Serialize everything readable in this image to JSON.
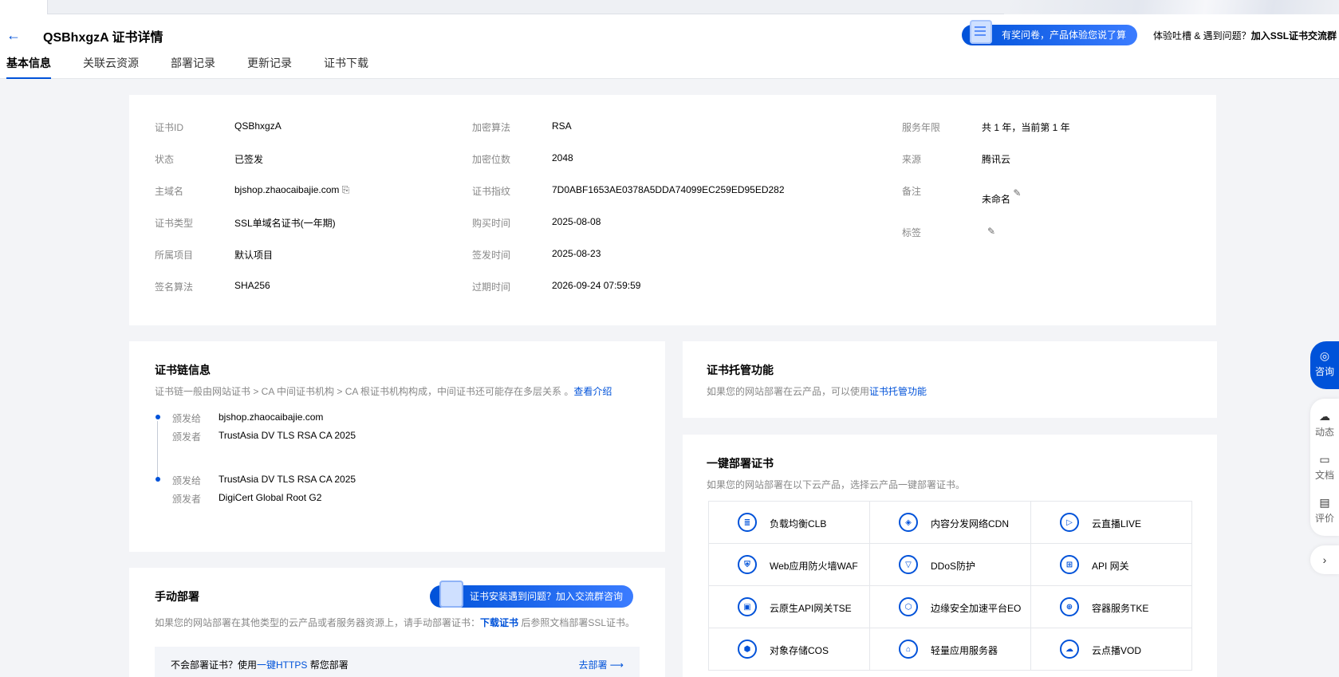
{
  "header": {
    "back_icon": "arrow-left-icon",
    "title": "QSBhxgzA 证书详情",
    "survey_label": "有奖问卷，产品体验您说了算",
    "feedback_prefix": "体验吐槽 & 遇到问题？",
    "feedback_link": "加入SSL证书交流群",
    "tabs": [
      "基本信息",
      "关联云资源",
      "部署记录",
      "更新记录",
      "证书下载"
    ]
  },
  "info": {
    "col1": [
      {
        "k": "证书ID",
        "v": "QSBhxgzA"
      },
      {
        "k": "状态",
        "v": "已签发"
      },
      {
        "k": "主域名",
        "v": "bjshop.zhaocaibajie.com"
      },
      {
        "k": "证书类型",
        "v": "SSL单域名证书(一年期)"
      },
      {
        "k": "所属项目",
        "v": "默认项目"
      },
      {
        "k": "签名算法",
        "v": "SHA256"
      }
    ],
    "col2": [
      {
        "k": "加密算法",
        "v": "RSA"
      },
      {
        "k": "加密位数",
        "v": "2048"
      },
      {
        "k": "证书指纹",
        "v": "7D0ABF1653AE0378A5DDA74099EC259ED95ED282"
      },
      {
        "k": "购买时间",
        "v": "2025-08-08"
      },
      {
        "k": "签发时间",
        "v": "2025-08-23"
      },
      {
        "k": "过期时间",
        "v": "2026-09-24 07:59:59"
      }
    ],
    "col3": [
      {
        "k": "服务年限",
        "v": "共 1 年，当前第 1 年"
      },
      {
        "k": "来源",
        "v": "腾讯云"
      },
      {
        "k": "备注",
        "v": "未命名"
      },
      {
        "k": "标签",
        "v": ""
      }
    ]
  },
  "chain": {
    "title": "证书链信息",
    "desc": "证书链一般由网站证书 > CA 中间证书机构 > CA 根证书机构构成，中间证书还可能存在多层关系 。",
    "desc_link": "查看介绍",
    "issued_to_label": "颁发给",
    "issuer_label": "颁发者",
    "items": [
      {
        "to": "bjshop.zhaocaibajie.com",
        "by": "TrustAsia DV TLS RSA CA 2025"
      },
      {
        "to": "TrustAsia DV TLS RSA CA 2025",
        "by": "DigiCert Global Root G2"
      }
    ]
  },
  "manual": {
    "title": "手动部署",
    "help_pill": "证书安装遇到问题？加入交流群咨询",
    "desc_pre": "如果您的网站部署在其他类型的云产品或者服务器资源上，请手动部署证书：",
    "desc_link": "下载证书",
    "desc_post": "后参照文档部署SSL证书。",
    "notice_pre": "不会部署证书？使用",
    "notice_link": "一键HTTPS",
    "notice_post": "帮您部署",
    "go_label": "去部署 ⟶"
  },
  "hosting": {
    "title": "证书托管功能",
    "desc_pre": "如果您的网站部署在云产品，可以使用",
    "desc_link": "证书托管功能"
  },
  "deploy": {
    "title": "一键部署证书",
    "desc": "如果您的网站部署在以下云产品，选择云产品一键部署证书。",
    "products": [
      {
        "icon": "load-balancer-icon",
        "glyph": "≣",
        "label": "负载均衡CLB"
      },
      {
        "icon": "cdn-icon",
        "glyph": "◈",
        "label": "内容分发网络CDN"
      },
      {
        "icon": "live-icon",
        "glyph": "▷",
        "label": "云直播LIVE"
      },
      {
        "icon": "waf-icon",
        "glyph": "⛨",
        "label": "Web应用防火墙WAF"
      },
      {
        "icon": "ddos-icon",
        "glyph": "▽",
        "label": "DDoS防护"
      },
      {
        "icon": "api-gateway-icon",
        "glyph": "⊞",
        "label": "API 网关"
      },
      {
        "icon": "tse-icon",
        "glyph": "▣",
        "label": "云原生API网关TSE"
      },
      {
        "icon": "edgeone-icon",
        "glyph": "⬡",
        "label": "边缘安全加速平台EO"
      },
      {
        "icon": "tke-icon",
        "glyph": "⊕",
        "label": "容器服务TKE"
      },
      {
        "icon": "cos-icon",
        "glyph": "⬢",
        "label": "对象存储COS"
      },
      {
        "icon": "lighthouse-icon",
        "glyph": "⌂",
        "label": "轻量应用服务器"
      },
      {
        "icon": "vod-icon",
        "glyph": "☁",
        "label": "云点播VOD"
      }
    ]
  },
  "sidebar": {
    "consult": "咨询",
    "items": [
      "动态",
      "文档",
      "评价"
    ]
  }
}
